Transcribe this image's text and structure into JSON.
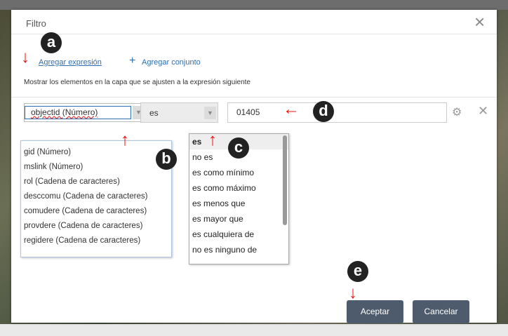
{
  "background": {
    "footer_text": ""
  },
  "dialog": {
    "title": "Filtro",
    "add_expression": "Agregar expresión",
    "add_set": "Agregar conjunto",
    "description": "Mostrar los elementos en la capa que se ajusten a la expresión siguiente",
    "field_value": "objectid (Número)",
    "operator_value": "es",
    "input_value": "01405",
    "field_options": [
      "gid (Número)",
      "mslink (Número)",
      "rol (Cadena de caracteres)",
      "desccomu (Cadena de caracteres)",
      "comudere (Cadena de caracteres)",
      "provdere (Cadena de caracteres)",
      "regidere (Cadena de caracteres)"
    ],
    "operator_options": [
      "es",
      "no es",
      "es como mínimo",
      "es como máximo",
      "es menos que",
      "es mayor que",
      "es cualquiera de",
      "no es ninguno de"
    ],
    "ok_label": "Aceptar",
    "cancel_label": "Cancelar"
  },
  "annotations": {
    "a": "a",
    "b": "b",
    "c": "c",
    "d": "d",
    "e": "e"
  },
  "colors": {
    "accent": "#2c6fb4",
    "button": "#4d5b6c",
    "annotation_arrow": "#e11111"
  }
}
